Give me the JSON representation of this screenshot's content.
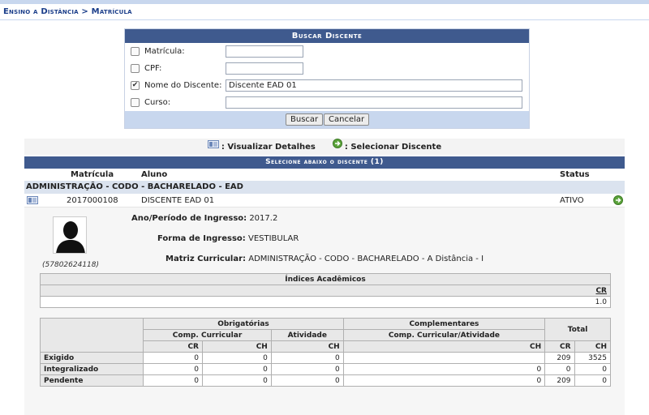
{
  "breadcrumb": "Ensino a Distância > Matrícula",
  "search": {
    "title": "Buscar Discente",
    "fields": [
      {
        "label": "Matrícula:",
        "checked": false,
        "value": "",
        "width": 96
      },
      {
        "label": "CPF:",
        "checked": false,
        "value": "",
        "width": 96
      },
      {
        "label": "Nome do Discente:",
        "checked": true,
        "value": "Discente EAD 01",
        "width": 366
      },
      {
        "label": "Curso:",
        "checked": false,
        "value": "",
        "width": 366
      }
    ],
    "buttons": {
      "search": "Buscar",
      "cancel": "Cancelar"
    }
  },
  "legend": {
    "details": ": Visualizar Detalhes",
    "select": ": Selecionar Discente"
  },
  "results": {
    "title": "Selecione abaixo o discente (1)",
    "headers": {
      "matricula": "Matrícula",
      "aluno": "Aluno",
      "status": "Status"
    },
    "group": "ADMINISTRAÇÃO - CODO - BACHARELADO - EAD",
    "row": {
      "matricula": "2017000108",
      "aluno": "DISCENTE EAD 01",
      "status": "ATIVO"
    }
  },
  "details": {
    "photo_id": "(57802624118)",
    "ingresso_label": "Ano/Período de Ingresso:",
    "ingresso_value": " 2017.2",
    "forma_label": "Forma de Ingresso:",
    "forma_value": " VESTIBULAR",
    "matriz_label": "Matriz Curricular:",
    "matriz_value": " ADMINISTRAÇÃO - CODO - BACHARELADO - A Distância - I"
  },
  "indices": {
    "title": "Índices Acadêmicos",
    "cr_label": "CR",
    "cr_value": "1.0"
  },
  "workload": {
    "obrigatorias": "Obrigatórias",
    "complementares": "Complementares",
    "total": "Total",
    "comp_curricular": "Comp. Curricular",
    "atividade": "Atividade",
    "comp_curr_ativ": "Comp. Curricular/Atividade",
    "cr": "CR",
    "ch": "CH",
    "rows": [
      {
        "label": "Exigido",
        "cells": [
          "0",
          "0",
          "0",
          "",
          "209",
          "3525"
        ]
      },
      {
        "label": "Integralizado",
        "cells": [
          "0",
          "0",
          "0",
          "0",
          "0",
          "0"
        ]
      },
      {
        "label": "Pendente",
        "cells": [
          "0",
          "0",
          "0",
          "0",
          "209",
          "0"
        ]
      }
    ]
  }
}
